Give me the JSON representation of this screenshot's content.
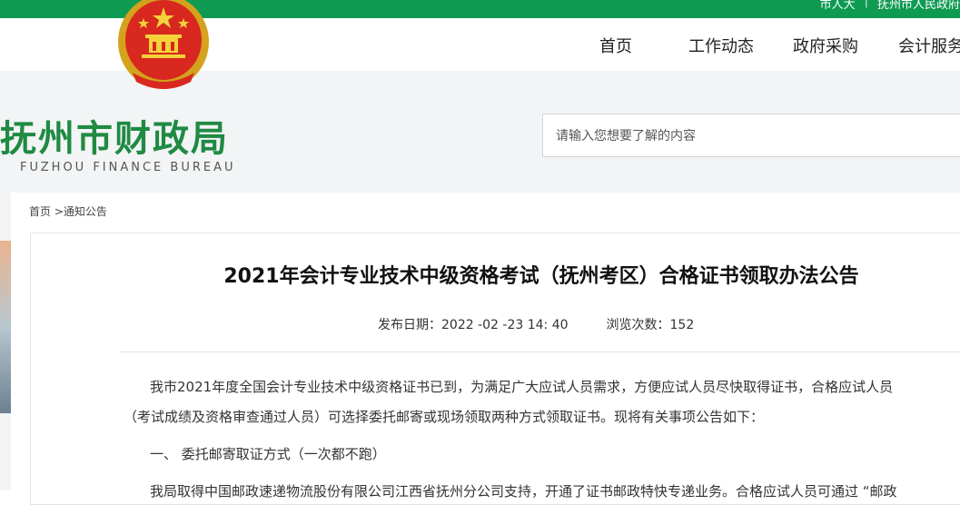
{
  "header": {
    "top_links": [
      "市人大",
      "|",
      "抚州市人民政府"
    ],
    "nav": [
      "首页",
      "工作动态",
      "政府采购",
      "会计服务"
    ]
  },
  "brand": {
    "name_cn": "抚州市财政局",
    "name_en": "FUZHOU FINANCE BUREAU"
  },
  "search": {
    "placeholder": "请输入您想要了解的内容"
  },
  "breadcrumb": {
    "home": "首页",
    "current": ">通知公告"
  },
  "article": {
    "title": "2021年会计专业技术中级资格考试（抚州考区）合格证书领取办法公告",
    "publish_label": "发布日期：",
    "publish_date": "2022 -02 -23 14: 40",
    "views_label": "浏览次数：",
    "views": "152",
    "para1": "我市2021年度全国会计专业技术中级资格证书已到，为满足广大应试人员需求，方便应试人员尽快取得证书，合格应试人员",
    "para2": "（考试成绩及资格审查通过人员）可选择委托邮寄或现场领取两种方式领取证书。现将有关事项公告如下：",
    "section1": "一、 委托邮寄取证方式（一次都不跑）",
    "para3": "我局取得中国邮政速递物流股份有限公司江西省抚州分公司支持，开通了证书邮政特快专递业务。合格应试人员可通过 “邮政"
  },
  "colors": {
    "brand_green": "#0f9a52",
    "logo_green": "#1f8a43"
  }
}
